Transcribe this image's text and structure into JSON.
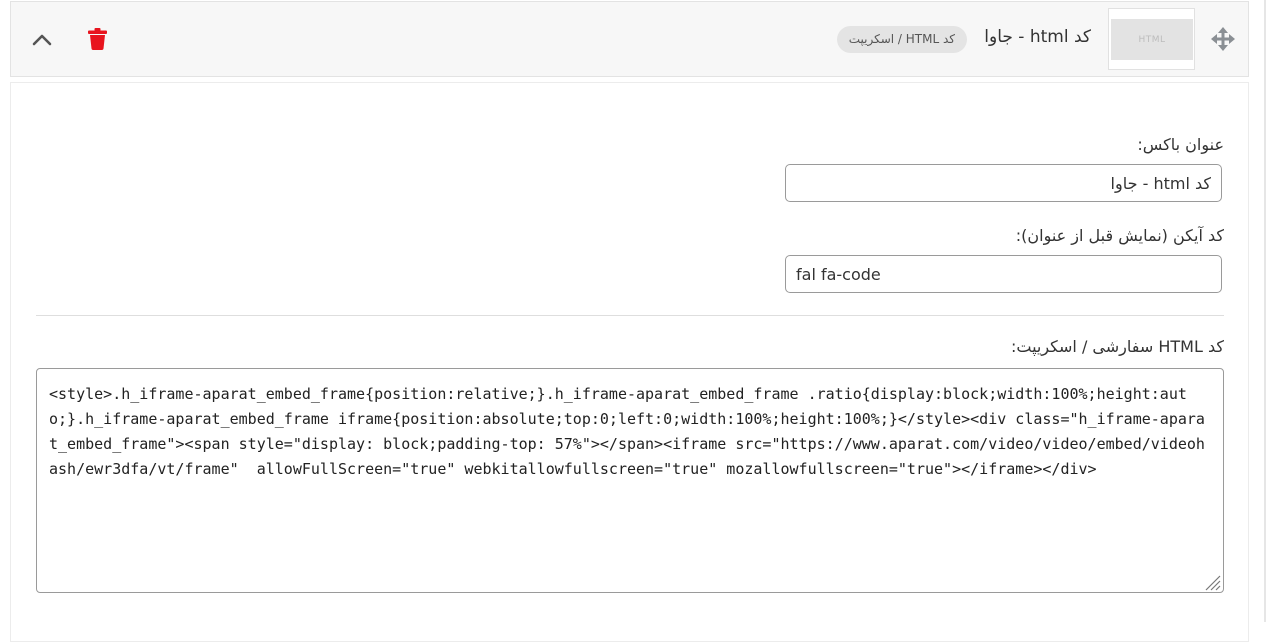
{
  "header": {
    "title": "کد html - جاوا",
    "badge": "کد HTML / اسکریپت",
    "thumbnail_text": "HTML",
    "icons": {
      "move": "arrows-move-icon",
      "delete": "trash-icon",
      "collapse": "chevron-up-icon"
    },
    "colors": {
      "delete": "#e8141e",
      "icon_gray": "#8a8f94"
    }
  },
  "form": {
    "box_title": {
      "label": "عنوان باکس:",
      "value": "کد html - جاوا"
    },
    "icon_code": {
      "label": "کد آیکن (نمایش قبل از عنوان):",
      "value": "fal fa-code"
    },
    "custom_html": {
      "label": "کد HTML سفارشی / اسکریپت:",
      "value": "<style>.h_iframe-aparat_embed_frame{position:relative;}.h_iframe-aparat_embed_frame .ratio{display:block;width:100%;height:auto;}.h_iframe-aparat_embed_frame iframe{position:absolute;top:0;left:0;width:100%;height:100%;}</style><div class=\"h_iframe-aparat_embed_frame\"><span style=\"display: block;padding-top: 57%\"></span><iframe src=\"https://www.aparat.com/video/video/embed/videohash/ewr3dfa/vt/frame\"  allowFullScreen=\"true\" webkitallowfullscreen=\"true\" mozallowfullscreen=\"true\"></iframe></div>"
    }
  }
}
